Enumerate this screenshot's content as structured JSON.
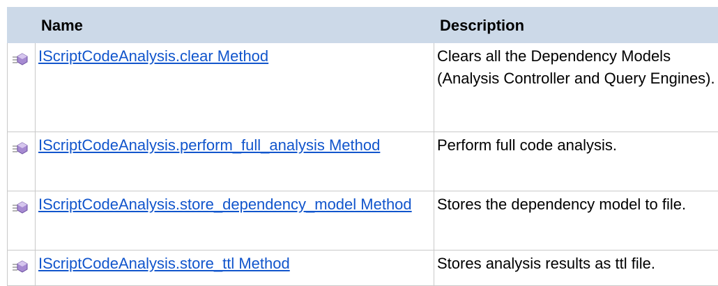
{
  "table": {
    "headers": {
      "icon": "",
      "name": "Name",
      "description": "Description"
    },
    "rows": [
      {
        "icon": "public-method-icon",
        "name": "IScriptCodeAnalysis.clear Method",
        "description": "Clears all the Dependency Models (Analysis Controller and Query Engines)."
      },
      {
        "icon": "public-method-icon",
        "name": "IScriptCodeAnalysis.perform_full_analysis Method",
        "description": "Perform full code analysis."
      },
      {
        "icon": "public-method-icon",
        "name": "IScriptCodeAnalysis.store_dependency_model Method",
        "description": "Stores the dependency model to file."
      },
      {
        "icon": "public-method-icon",
        "name": "IScriptCodeAnalysis.store_ttl Method",
        "description": "Stores analysis results as ttl file."
      }
    ]
  },
  "colors": {
    "header_background": "#ccd9e8",
    "link": "#1155cc",
    "grid": "#c9c9c9",
    "icon_purple": "#a68ad1"
  }
}
